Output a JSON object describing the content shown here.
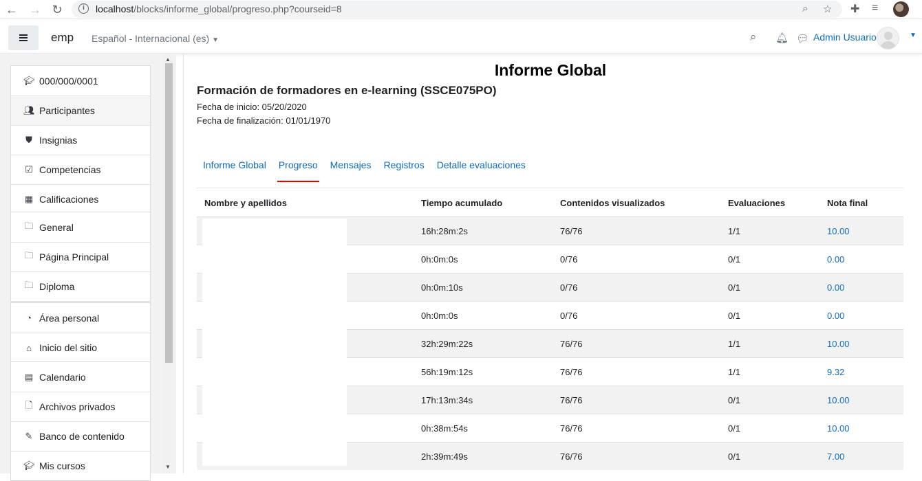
{
  "browser": {
    "url_host": "localhost",
    "url_path": "/blocks/informe_global/progreso.php?courseid=8"
  },
  "navbar": {
    "site_name": "emp",
    "language": "Español - Internacional (es)",
    "user_name": "Admin Usuario"
  },
  "sidebar": {
    "groups": [
      [
        {
          "icon": "graduation-cap-icon",
          "label": "000/000/0001"
        },
        {
          "icon": "users-icon",
          "label": "Participantes"
        },
        {
          "icon": "shield-icon",
          "label": "Insignias"
        },
        {
          "icon": "checkbox-icon",
          "label": "Competencias"
        },
        {
          "icon": "table-icon",
          "label": "Calificaciones"
        }
      ],
      [
        {
          "icon": "folder-icon",
          "label": "General"
        },
        {
          "icon": "folder-icon",
          "label": "Página Principal"
        },
        {
          "icon": "folder-icon",
          "label": "Diploma"
        }
      ],
      [
        {
          "icon": "dashboard-icon",
          "label": "Área personal"
        },
        {
          "icon": "home-icon",
          "label": "Inicio del sitio"
        }
      ],
      [
        {
          "icon": "calendar-icon",
          "label": "Calendario"
        },
        {
          "icon": "file-icon",
          "label": "Archivos privados"
        },
        {
          "icon": "paintbrush-icon",
          "label": "Banco de contenido"
        },
        {
          "icon": "graduation-cap-icon",
          "label": "Mis cursos"
        }
      ]
    ]
  },
  "main": {
    "title": "Informe Global",
    "course_title": "Formación de formadores en e-learning (SSCE075PO)",
    "start_date": "Fecha de inicio: 05/20/2020",
    "end_date": "Fecha de finalización: 01/01/1970",
    "tabs": [
      {
        "label": "Informe Global",
        "active": false
      },
      {
        "label": "Progreso",
        "active": true
      },
      {
        "label": "Mensajes",
        "active": false
      },
      {
        "label": "Registros",
        "active": false
      },
      {
        "label": "Detalle evaluaciones",
        "active": false
      }
    ],
    "table": {
      "headers": [
        "Nombre y apellidos",
        "Tiempo acumulado",
        "Contenidos visualizados",
        "Evaluaciones",
        "Nota final"
      ],
      "rows": [
        {
          "name": "",
          "time": "16h:28m:2s",
          "contents": "76/76",
          "evaluations": "1/1",
          "grade": "10.00"
        },
        {
          "name": "",
          "time": "0h:0m:0s",
          "contents": "0/76",
          "evaluations": "0/1",
          "grade": "0.00"
        },
        {
          "name": "",
          "time": "0h:0m:10s",
          "contents": "0/76",
          "evaluations": "0/1",
          "grade": "0.00"
        },
        {
          "name": "",
          "time": "0h:0m:0s",
          "contents": "0/76",
          "evaluations": "0/1",
          "grade": "0.00"
        },
        {
          "name": "",
          "time": "32h:29m:22s",
          "contents": "76/76",
          "evaluations": "1/1",
          "grade": "10.00"
        },
        {
          "name": "",
          "time": "56h:19m:12s",
          "contents": "76/76",
          "evaluations": "1/1",
          "grade": "9.32"
        },
        {
          "name": "",
          "time": "17h:13m:34s",
          "contents": "76/76",
          "evaluations": "0/1",
          "grade": "10.00"
        },
        {
          "name": "",
          "time": "0h:38m:54s",
          "contents": "76/76",
          "evaluations": "0/1",
          "grade": "10.00"
        },
        {
          "name": "",
          "time": "2h:39m:49s",
          "contents": "76/76",
          "evaluations": "0/1",
          "grade": "7.00"
        }
      ]
    }
  }
}
